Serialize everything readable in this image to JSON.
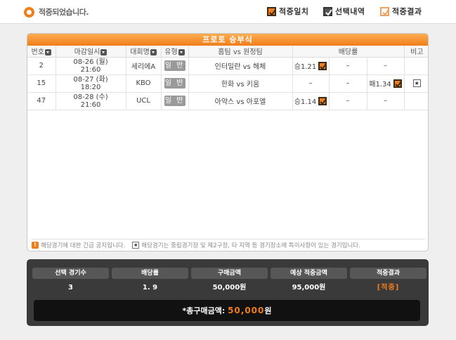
{
  "header": {
    "status_text": "적중되었습니다.",
    "legend": [
      {
        "label": "적중일치",
        "icon": "orange-check-box-icon"
      },
      {
        "label": "선택내역",
        "icon": "gray-check-box-icon"
      },
      {
        "label": "적중결과",
        "icon": "outline-check-box-icon"
      }
    ]
  },
  "panel": {
    "title": "프로토 승부식",
    "columns": {
      "no": "번호",
      "deadline": "마감일시",
      "league": "대회명",
      "type": "유형",
      "match_home": "홈팀",
      "match_vs": "vs",
      "match_away": "원정팀",
      "odds": "배당률",
      "note": "비고"
    },
    "rows": [
      {
        "no": "2",
        "date": "08-26 (월)",
        "time": "21:60",
        "league": "세리에A",
        "type": "일 반",
        "home": "인터밀란",
        "vs": "vs",
        "away": "헤체",
        "odd1": "승1.21",
        "odd1_checked": true,
        "odd2": "–",
        "odd3": "–",
        "note": ""
      },
      {
        "no": "15",
        "date": "08-27 (화)",
        "time": "18:20",
        "league": "KBO",
        "type": "일 반",
        "home": "한화",
        "vs": "vs",
        "away": "키움",
        "odd1": "–",
        "odd1_checked": false,
        "odd2": "–",
        "odd3": "패1.34",
        "odd3_checked": true,
        "note": "★"
      },
      {
        "no": "47",
        "date": "08-28 (수)",
        "time": "21:60",
        "league": "UCL",
        "type": "일 반",
        "home": "아약스",
        "vs": "vs",
        "away": "아포엘",
        "odd1": "승1.14",
        "odd1_checked": true,
        "odd2": "–",
        "odd3": "–",
        "note": ""
      }
    ],
    "notice_left": "해당경기에 대한 긴급 공지입니다.",
    "notice_right": "해당경기는 중립경기장 및 제2구장, 타 지역 등 경기장소에 특이사항이 있는 경기입니다.",
    "notice_star": "★",
    "notice_mark": "!"
  },
  "summary": {
    "headers": [
      "선택 경기수",
      "배당률",
      "구매금액",
      "예상 적중금액",
      "적중결과"
    ],
    "values": [
      "3",
      "1. 9",
      "50,000원",
      "95,000원",
      "[적중]"
    ],
    "total_label": "*총구매금액: ",
    "total_amount": "50,000",
    "total_unit": "원"
  },
  "colors": {
    "accent": "#f07d1a",
    "summary_bg": "#3a3a3a"
  }
}
